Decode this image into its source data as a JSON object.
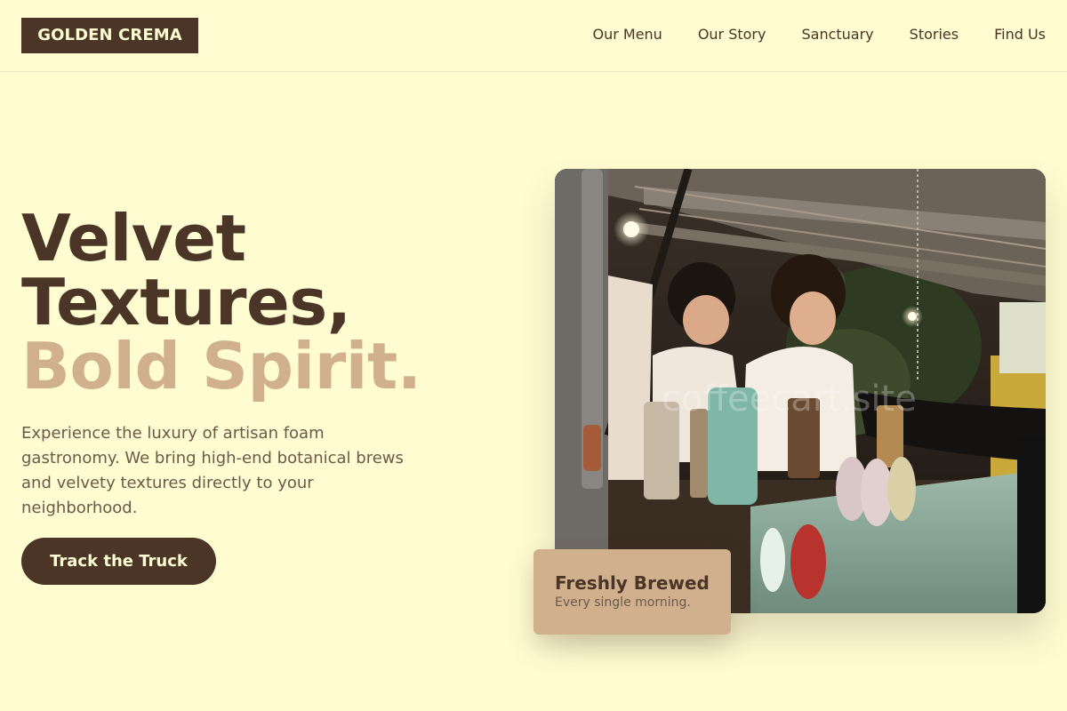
{
  "header": {
    "logo": "GOLDEN CREMA",
    "nav": [
      {
        "label": "Our Menu"
      },
      {
        "label": "Our Story"
      },
      {
        "label": "Sanctuary"
      },
      {
        "label": "Stories"
      },
      {
        "label": "Find Us"
      }
    ]
  },
  "hero": {
    "title_line1": "Velvet",
    "title_line2": "Textures,",
    "title_accent": "Bold Spirit.",
    "description": "Experience the luxury of artisan foam gastronomy. We bring high-end botanical brews and velvety textures directly to your neighborhood.",
    "cta_label": "Track the Truck"
  },
  "photo": {
    "watermark": "coffeecart.site"
  },
  "badge": {
    "title": "Freshly Brewed",
    "subtitle": "Every single morning."
  },
  "colors": {
    "background": "#FFFCD2",
    "primary": "#4A3526",
    "accent": "#D1B08E",
    "muted_text": "#6B5A4A"
  }
}
